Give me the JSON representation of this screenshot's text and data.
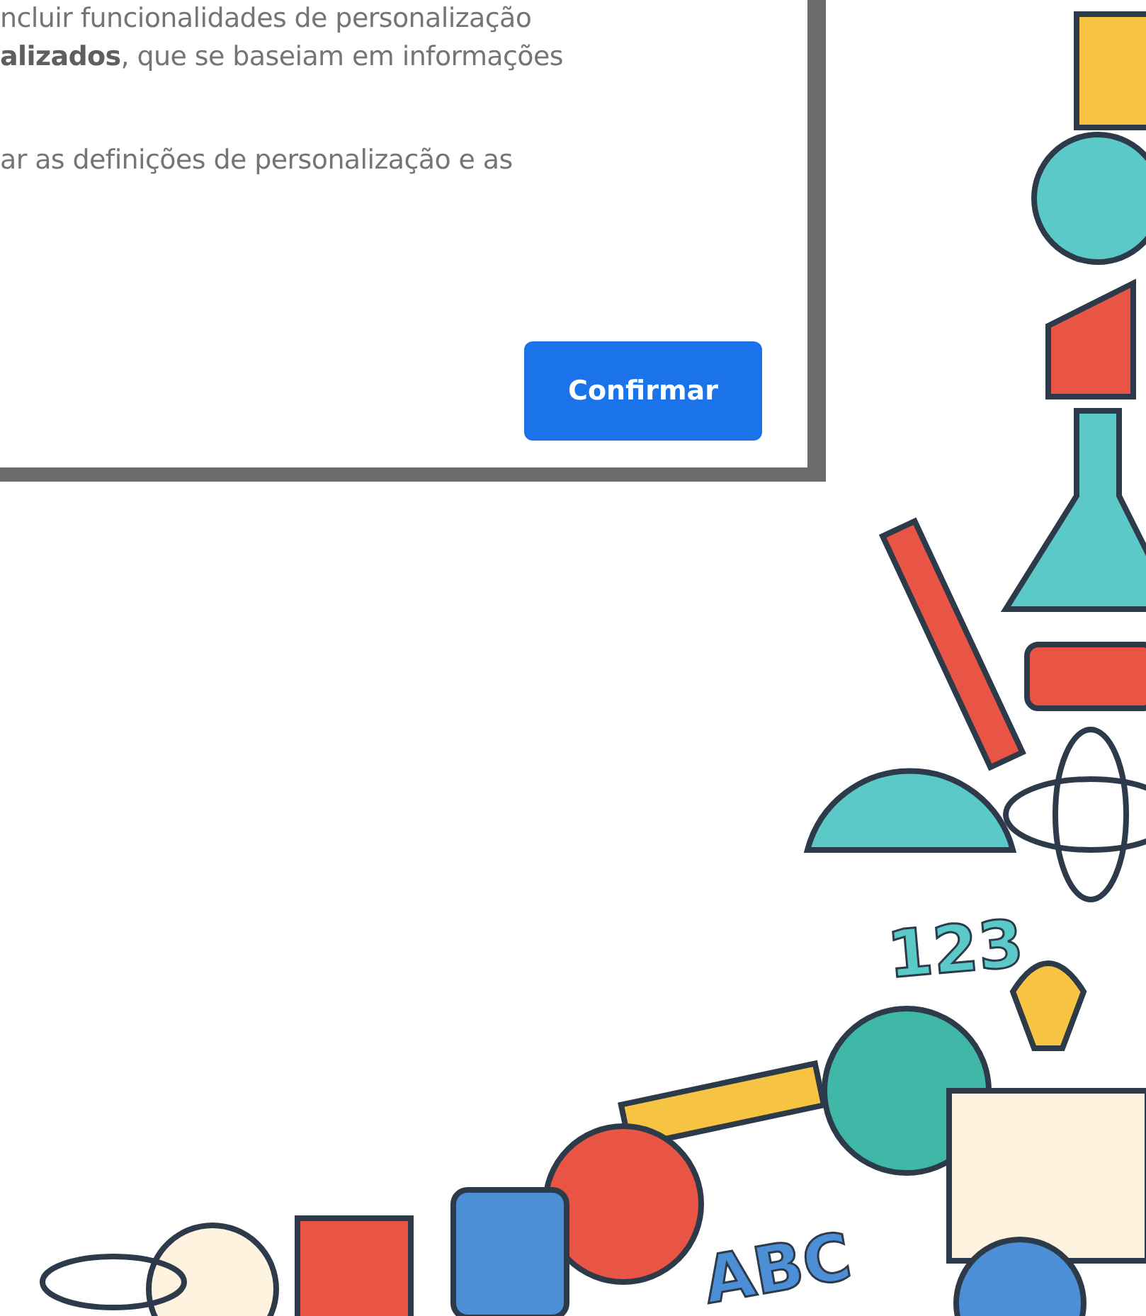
{
  "dialog": {
    "paragraphs": [
      {
        "lines": [
          "ncluir funcionalidades de personalização",
          "**alizados**, que se baseiam em informações"
        ]
      },
      {
        "lines": [
          "ar as definições de personalização e as"
        ]
      }
    ],
    "buttons": [
      {
        "label": "Confirmar",
        "kind": "primary"
      }
    ]
  },
  "background": {
    "sticker_texts": [
      "123",
      "ABC"
    ]
  }
}
